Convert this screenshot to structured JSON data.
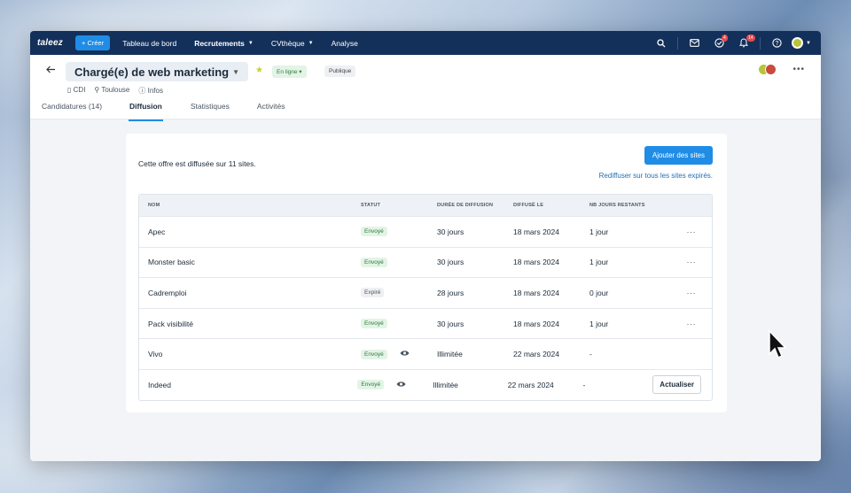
{
  "app": {
    "logo": "taleez"
  },
  "topnav": {
    "create_label": "+ Créer",
    "links": [
      {
        "label": "Tableau de bord",
        "caret": false,
        "active": false
      },
      {
        "label": "Recrutements",
        "caret": true,
        "active": true
      },
      {
        "label": "CVthèque",
        "caret": true,
        "active": false
      },
      {
        "label": "Analyse",
        "caret": false,
        "active": false
      }
    ],
    "tasks_badge": "4",
    "notifications_badge": "14"
  },
  "header": {
    "job_title": "Chargé(e) de web marketing",
    "status_pill": "En ligne",
    "visibility_pill": "Publique",
    "contract": "CDI",
    "location": "Toulouse",
    "infos": "Infos"
  },
  "tabs": [
    {
      "label": "Candidatures (14)",
      "active": false
    },
    {
      "label": "Diffusion",
      "active": true
    },
    {
      "label": "Statistiques",
      "active": false
    },
    {
      "label": "Activités",
      "active": false
    }
  ],
  "card": {
    "info_text": "Cette offre est diffusée sur 11 sites.",
    "add_button": "Ajouter des sites",
    "rediffuse_link": "Rediffuser sur tous les sites expirés."
  },
  "table": {
    "headers": [
      "NOM",
      "STATUT",
      "DURÉE DE DIFFUSION",
      "DIFFUSÉ LE",
      "NB JOURS RESTANTS"
    ],
    "rows": [
      {
        "name": "Apec",
        "status": "Envoyé",
        "status_type": "sent",
        "eye": false,
        "duration": "30 jours",
        "date": "18 mars 2024",
        "days": "1 jour",
        "action": "menu"
      },
      {
        "name": "Monster basic",
        "status": "Envoyé",
        "status_type": "sent",
        "eye": false,
        "duration": "30 jours",
        "date": "18 mars 2024",
        "days": "1 jour",
        "action": "menu"
      },
      {
        "name": "Cadremploi",
        "status": "Expiré",
        "status_type": "expired",
        "eye": false,
        "duration": "28 jours",
        "date": "18 mars 2024",
        "days": "0 jour",
        "action": "menu"
      },
      {
        "name": "Pack visibilité",
        "status": "Envoyé",
        "status_type": "sent",
        "eye": false,
        "duration": "30 jours",
        "date": "18 mars 2024",
        "days": "1 jour",
        "action": "menu"
      },
      {
        "name": "Vivo",
        "status": "Envoyé",
        "status_type": "sent",
        "eye": true,
        "duration": "Illimitée",
        "date": "22 mars 2024",
        "days": "-",
        "action": "none"
      },
      {
        "name": "Indeed",
        "status": "Envoyé",
        "status_type": "sent",
        "eye": true,
        "duration": "Illimitée",
        "date": "22 mars 2024",
        "days": "-",
        "action": "update"
      }
    ],
    "update_button": "Actualiser"
  },
  "colors": {
    "nav_bg": "#13305a",
    "accent": "#1f8ce6",
    "sent_bg": "#e3f4e6",
    "sent_fg": "#2f7a3e"
  }
}
